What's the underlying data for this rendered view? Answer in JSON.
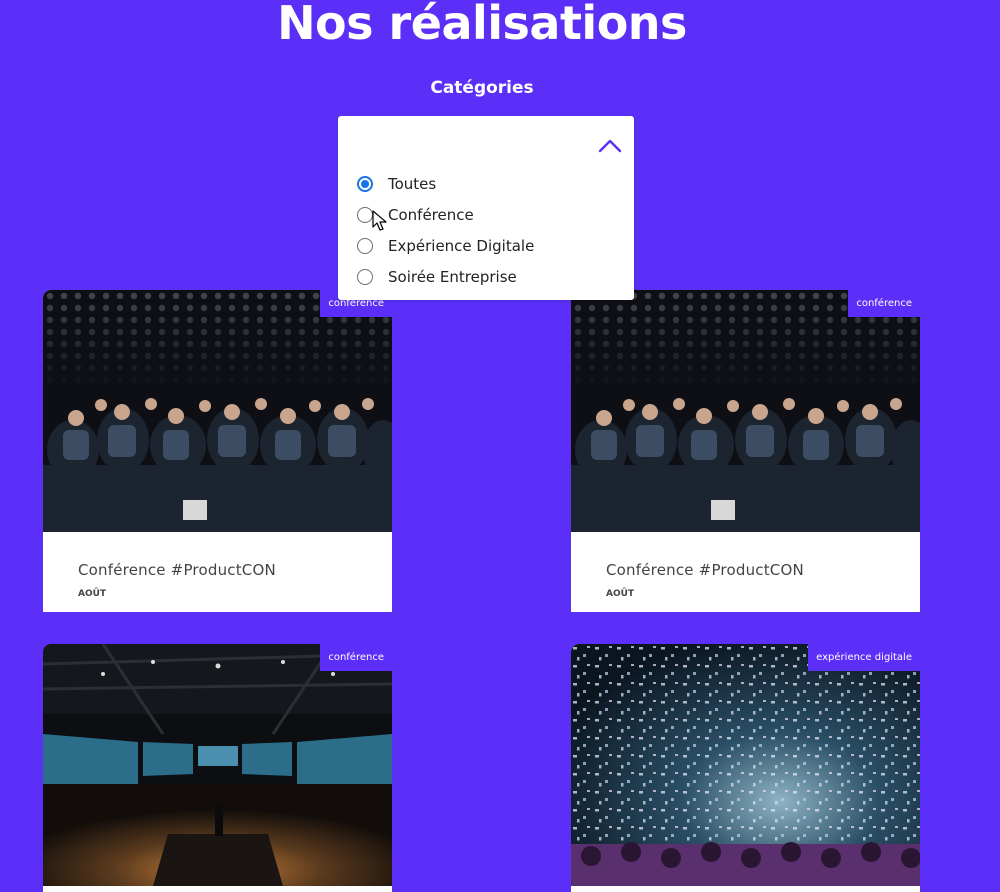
{
  "header": {
    "title": "Nos réalisations",
    "categories_label": "Catégories"
  },
  "filter": {
    "options": [
      {
        "label": "Toutes",
        "selected": true
      },
      {
        "label": "Conférence",
        "selected": false
      },
      {
        "label": "Expérience Digitale",
        "selected": false
      },
      {
        "label": "Soirée Entreprise",
        "selected": false
      }
    ],
    "expanded": true
  },
  "cards": [
    {
      "tag": "conférence",
      "title": "Conférence #ProductCON",
      "date": "AOÛT"
    },
    {
      "tag": "conférence",
      "title": "Conférence #ProductCON",
      "date": "AOÛT"
    },
    {
      "tag": "conférence",
      "title": "",
      "date": ""
    },
    {
      "tag": "expérience digitale",
      "title": "",
      "date": ""
    }
  ],
  "colors": {
    "background": "#5b2ff7",
    "tag_background": "#5b2ff7",
    "radio_selected": "#1a73e8",
    "card_background": "#ffffff"
  }
}
